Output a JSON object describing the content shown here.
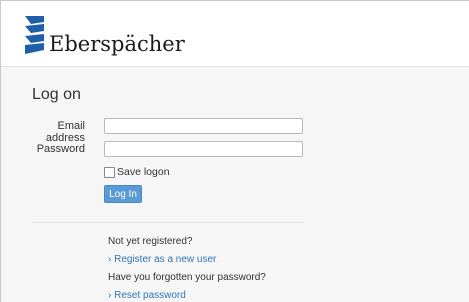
{
  "brand": {
    "name": "Eberspächer"
  },
  "login": {
    "title": "Log on",
    "email_label": "Email address",
    "email_value": "",
    "password_label": "Password",
    "password_value": "",
    "save_logon_label": "Save logon",
    "save_logon_checked": false,
    "login_button": "Log In"
  },
  "register": {
    "prompt": "Not yet registered?",
    "link": "› Register as a new user"
  },
  "forgot": {
    "prompt": "Have you forgotten your password?",
    "link": "› Reset password"
  },
  "colors": {
    "brand_blue": "#1f5fa8",
    "button_blue": "#5a9bd5",
    "link_blue": "#2f77b4"
  },
  "icons": {
    "logo": "eberspacher-logo-icon",
    "checkbox": "checkbox-icon"
  }
}
